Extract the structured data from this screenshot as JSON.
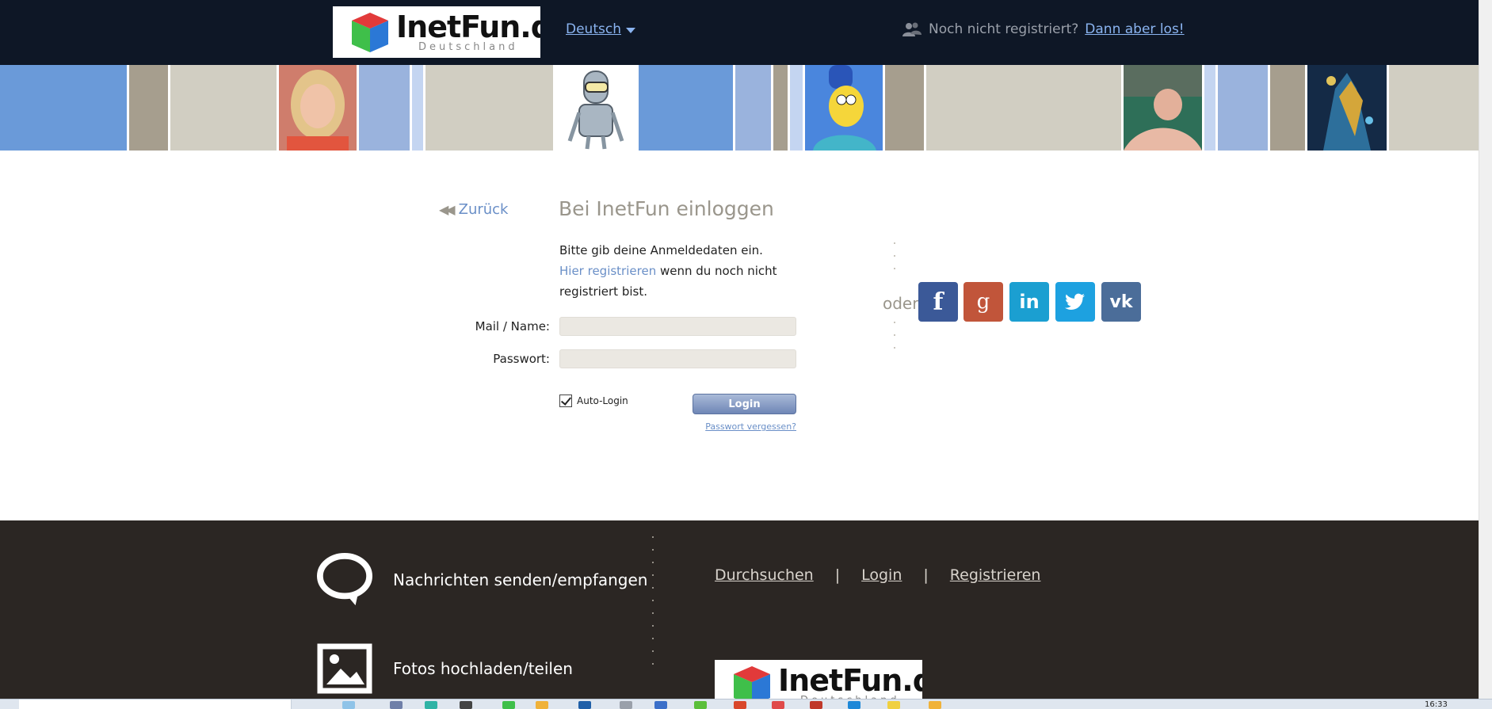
{
  "header": {
    "logo_text": "InetFun.de",
    "logo_subtitle": "Deutschland",
    "language": "Deutsch",
    "not_registered": "Noch nicht registriert?",
    "signup_link": "Dann aber los!"
  },
  "banner": {
    "tiles": [
      {
        "type": "color",
        "color": "#6a9ad9"
      },
      {
        "type": "color",
        "color": "#a69e8e"
      },
      {
        "type": "color",
        "color": "#d1cec2"
      },
      {
        "type": "photo",
        "label": "woman-avatar"
      },
      {
        "type": "color",
        "color": "#9ab3dd"
      },
      {
        "type": "color",
        "color": "#c4d5f1"
      },
      {
        "type": "color",
        "color": "#d1cec2"
      },
      {
        "type": "photo",
        "label": "robot-avatar"
      },
      {
        "type": "color",
        "color": "#6a9ad9"
      },
      {
        "type": "color",
        "color": "#9ab3dd"
      },
      {
        "type": "color",
        "color": "#a69e8e"
      },
      {
        "type": "color",
        "color": "#c4d5f1"
      },
      {
        "type": "photo",
        "label": "cartoon-avatar"
      },
      {
        "type": "color",
        "color": "#a69e8e"
      },
      {
        "type": "color",
        "color": "#d1cec2"
      },
      {
        "type": "photo",
        "label": "man-avatar"
      },
      {
        "type": "color",
        "color": "#c4d5f1"
      },
      {
        "type": "color",
        "color": "#9ab3dd"
      },
      {
        "type": "color",
        "color": "#a69e8e"
      },
      {
        "type": "photo",
        "label": "monster-avatar"
      },
      {
        "type": "color",
        "color": "#d1cec2"
      }
    ]
  },
  "login": {
    "back_label": "Zurück",
    "title": "Bei InetFun einloggen",
    "intro_line1": "Bitte gib deine Anmeldedaten ein.",
    "register_link": "Hier registrieren",
    "intro_rest": " wenn du noch nicht registriert bist.",
    "mail_label": "Mail / Name:",
    "mail_value": "",
    "password_label": "Passwort:",
    "password_value": "",
    "autologin_label": "Auto-Login",
    "autologin_checked": true,
    "login_button": "Login",
    "forgot_link": "Passwort vergessen?",
    "or_label": "oder"
  },
  "social": {
    "facebook": "f",
    "google": "g",
    "linkedin": "in",
    "twitter": "🐦",
    "vk": "vk"
  },
  "footer": {
    "feature_messages": "Nachrichten senden/empfangen",
    "feature_photos": "Fotos hochladen/teilen",
    "links": [
      "Durchsuchen",
      "Login",
      "Registrieren"
    ],
    "separator": "|",
    "logo_text": "InetFun.de",
    "logo_subtitle": "Deutschland"
  },
  "taskbar": {
    "clock": "16:33"
  },
  "colors": {
    "header_bg": "#0e1726",
    "link_blue": "#6a8fc7",
    "footer_bg": "#2b2623",
    "facebook": "#3b5998",
    "google": "#c1553a",
    "linkedin": "#1b9fd1",
    "twitter": "#1da1e0",
    "vk": "#4b6d99"
  }
}
